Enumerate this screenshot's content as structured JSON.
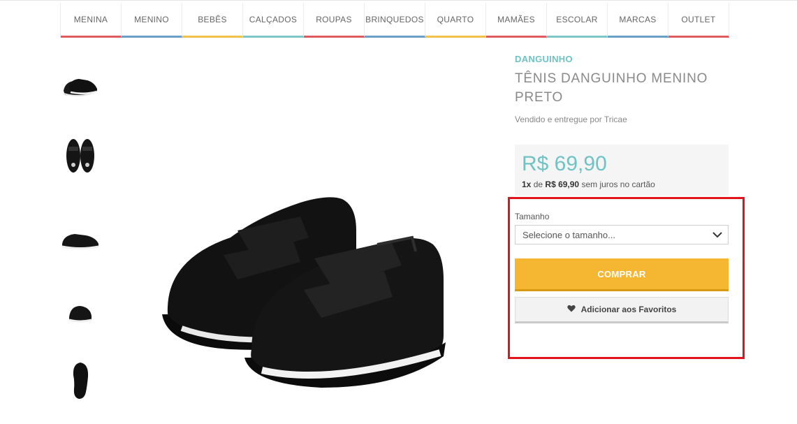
{
  "nav": {
    "items": [
      {
        "label": "MENINA",
        "color": "#e05a5f"
      },
      {
        "label": "MENINO",
        "color": "#6aa0c8"
      },
      {
        "label": "BEBÊS",
        "color": "#f1c24a"
      },
      {
        "label": "CALÇADOS",
        "color": "#7cc7c8"
      },
      {
        "label": "ROUPAS",
        "color": "#e05a5f"
      },
      {
        "label": "BRINQUEDOS",
        "color": "#6aa0c8"
      },
      {
        "label": "QUARTO",
        "color": "#f1c24a"
      },
      {
        "label": "MAMÃES",
        "color": "#e05a5f"
      },
      {
        "label": "ESCOLAR",
        "color": "#7cc7c8"
      },
      {
        "label": "MARCAS",
        "color": "#6aa0c8"
      },
      {
        "label": "OUTLET",
        "color": "#e05a5f"
      }
    ]
  },
  "product": {
    "brand": "DANGUINHO",
    "title": "TÊNIS DANGUINHO MENINO PRETO",
    "seller": "Vendido e entregue por Tricae",
    "price": "R$ 69,90",
    "installments": {
      "count": "1x",
      "connector": "de",
      "amount": "R$ 69,90",
      "suffix": "sem juros no cartão"
    }
  },
  "purchase": {
    "size_label": "Tamanho",
    "size_placeholder": "Selecione o tamanho...",
    "buy_label": "COMPRAR",
    "favorite_label": "Adicionar aos Favoritos"
  },
  "thumbnails": [
    {
      "view": "pair-side"
    },
    {
      "view": "pair-top"
    },
    {
      "view": "single-side"
    },
    {
      "view": "single-back"
    },
    {
      "view": "sole"
    }
  ],
  "colors": {
    "accent": "#6fc3c4",
    "buy": "#f5b731",
    "highlight": "#e3121b"
  }
}
